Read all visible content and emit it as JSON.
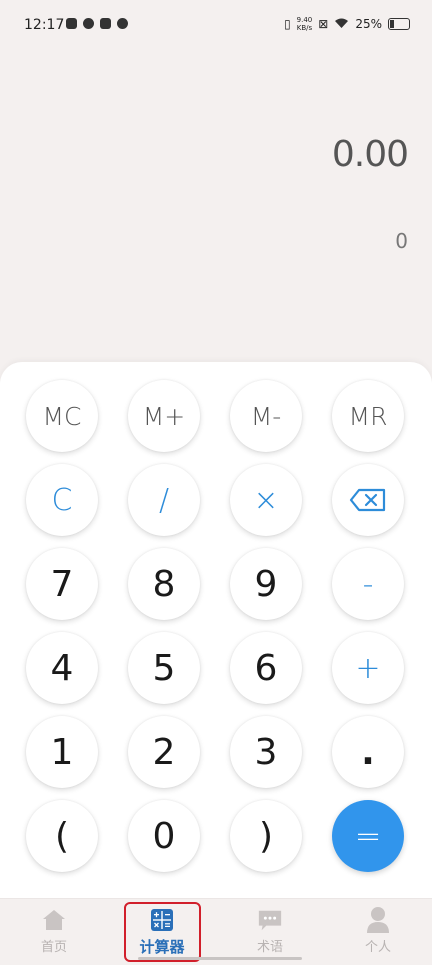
{
  "status_bar": {
    "time": "12:17",
    "net_speed_value": "9.40",
    "net_speed_unit": "KB/s",
    "battery": "25%"
  },
  "display": {
    "main_value": "0.00",
    "sub_value": "0"
  },
  "keypad": {
    "rows": [
      [
        "MC",
        "M+",
        "M-",
        "MR"
      ],
      [
        "C",
        "/",
        "×",
        "backspace"
      ],
      [
        "7",
        "8",
        "9",
        "-"
      ],
      [
        "4",
        "5",
        "6",
        "+"
      ],
      [
        "1",
        "2",
        "3",
        "."
      ],
      [
        "(",
        "0",
        ")",
        "="
      ]
    ],
    "accent_color": "#2d8cd9",
    "equals_color": "#3195ec"
  },
  "tabbar": {
    "tabs": [
      {
        "label": "首页",
        "icon": "home-icon"
      },
      {
        "label": "计算器",
        "icon": "calculator-icon"
      },
      {
        "label": "术语",
        "icon": "chat-icon"
      },
      {
        "label": "个人",
        "icon": "person-icon"
      }
    ],
    "active_index": 1,
    "active_color": "#2a6fb8",
    "inactive_color": "#b8b3b2"
  }
}
